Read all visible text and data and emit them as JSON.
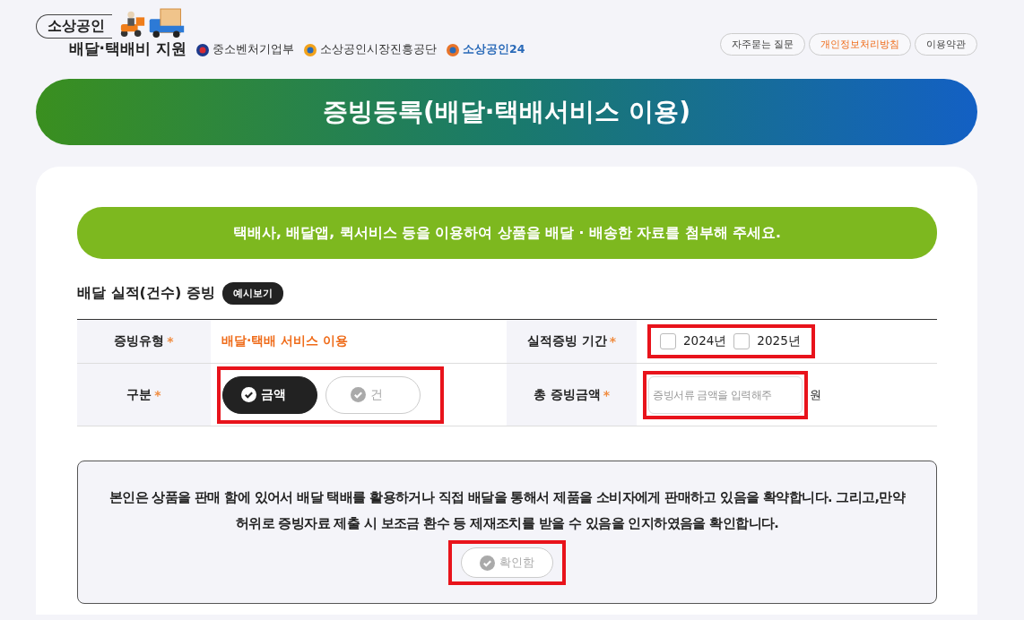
{
  "header": {
    "logo": {
      "top": "소상공인",
      "bottom": "배달·택배비 지원"
    },
    "agencies": [
      "중소벤처기업부",
      "소상공인시장진흥공단",
      "소상공인24"
    ],
    "links": [
      {
        "label": "자주묻는 질문",
        "highlighted": false
      },
      {
        "label": "개인정보처리방침",
        "highlighted": true
      },
      {
        "label": "이용약관",
        "highlighted": false
      }
    ]
  },
  "banner": {
    "title": "증빙등록(배달·택배서비스 이용)"
  },
  "notice": "택배사, 배달앱, 퀵서비스 등을 이용하여 상품을 배달 · 배송한 자료를 첨부해 주세요.",
  "section": {
    "title": "배달 실적(건수) 증빙",
    "button": "예시보기"
  },
  "form": {
    "type": {
      "label": "증빙유형",
      "required": "*",
      "value": "배달·택배 서비스 이용"
    },
    "period": {
      "label": "실적증빙 기간",
      "required": "*",
      "marked": true,
      "years": [
        {
          "label": "2024년",
          "checked": false
        },
        {
          "label": "2025년",
          "checked": false
        }
      ]
    },
    "category": {
      "label": "구분",
      "required": "*",
      "marked": true,
      "options": [
        {
          "label": "금액",
          "selected": true
        },
        {
          "label": "건",
          "selected": false
        }
      ]
    },
    "amount": {
      "label": "총 증빙금액",
      "required": "*",
      "placeholder": "증빙서류 금액을 입력해주",
      "unit": "원",
      "marked": true
    }
  },
  "pledge": {
    "text": "본인은 상품을 판매 함에 있어서 배달 택배를 활용하거나 직접 배달을 통해서 제품을 소비자에게 판매하고 있음을 확약합니다. 그리고,만약 허위로 증빙자료 제출 시 보조금 환수 등 제재조치를 받을 수 있음을 인지하였음을 확인합니다.",
    "button": {
      "label": "확인함",
      "checked": false
    },
    "marked": true
  }
}
